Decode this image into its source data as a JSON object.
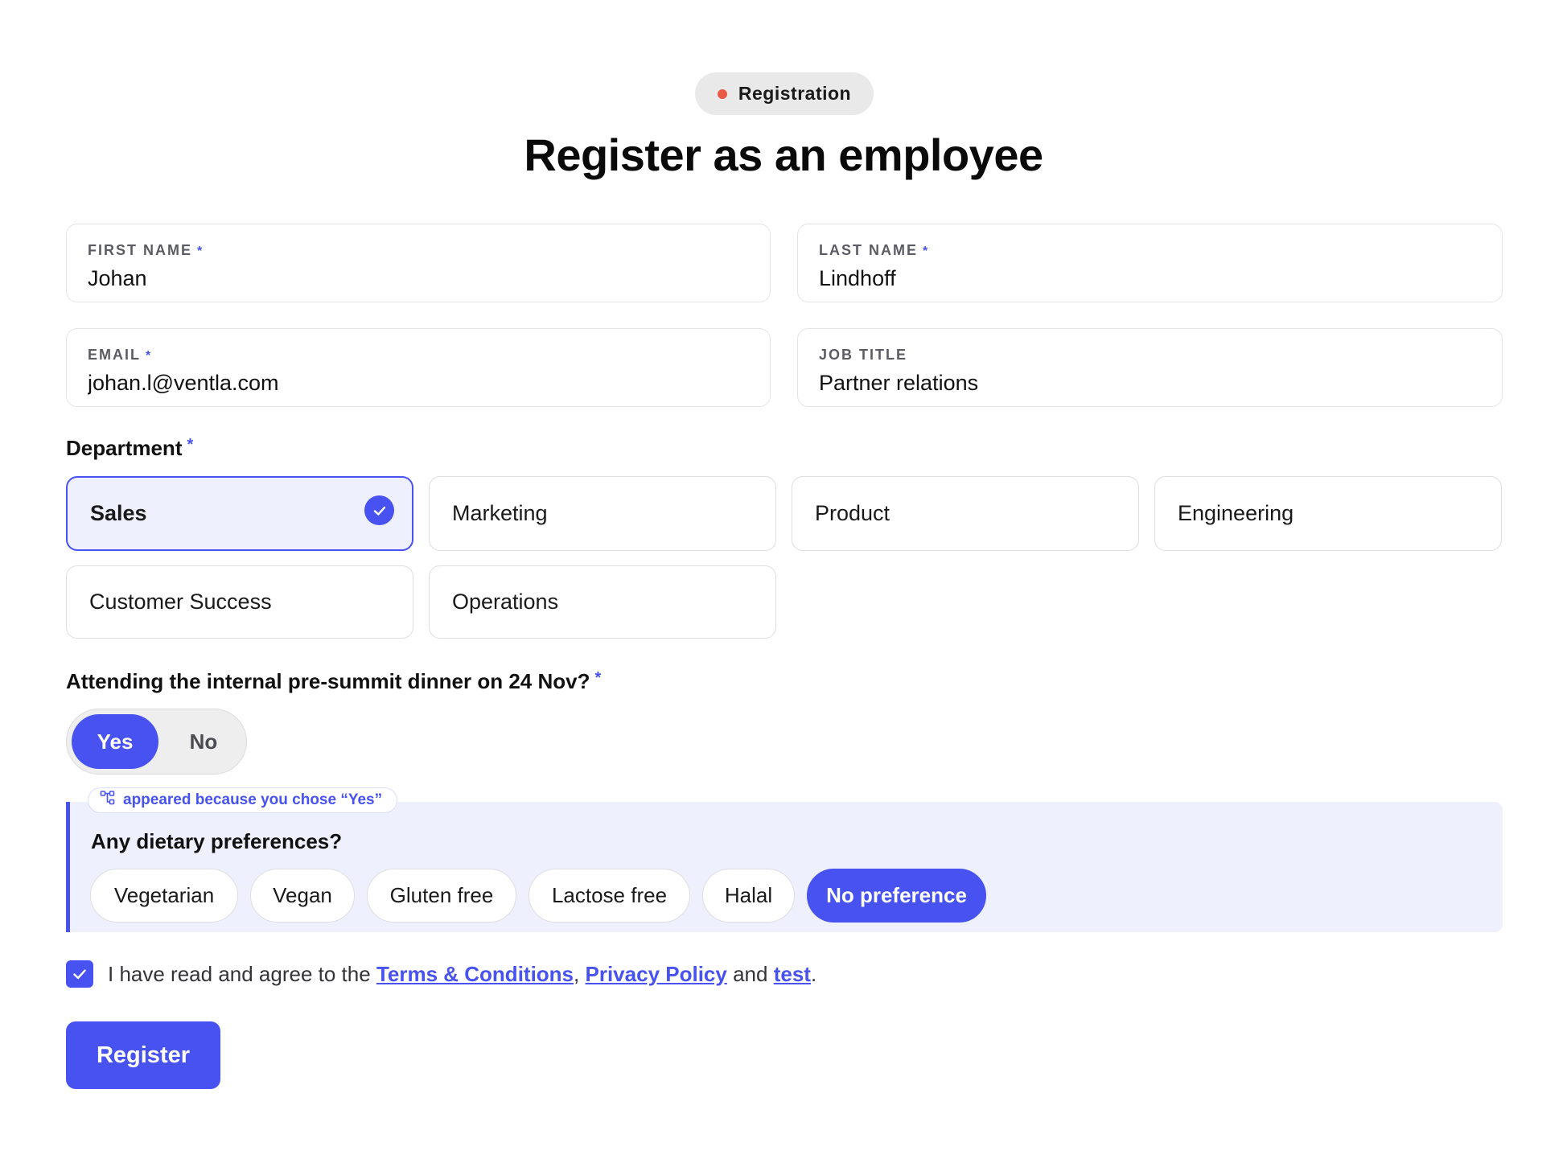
{
  "header": {
    "badge_label": "Registration",
    "title": "Register as an employee"
  },
  "fields": {
    "first_name": {
      "label": "FIRST NAME",
      "required_mark": "*",
      "value": "Johan"
    },
    "last_name": {
      "label": "LAST NAME",
      "required_mark": "*",
      "value": "Lindhoff"
    },
    "email": {
      "label": "EMAIL",
      "required_mark": "*",
      "value": "johan.l@ventla.com"
    },
    "job_title": {
      "label": "JOB TITLE",
      "value": "Partner relations"
    }
  },
  "department": {
    "label": "Department",
    "required_mark": "*",
    "options": [
      "Sales",
      "Marketing",
      "Product",
      "Engineering",
      "Customer Success",
      "Operations"
    ],
    "selected": "Sales"
  },
  "dinner": {
    "question": "Attending the internal pre-summit dinner on 24 Nov?",
    "required_mark": "*",
    "yes_label": "Yes",
    "no_label": "No",
    "selected": "Yes"
  },
  "dietary": {
    "condition_tag": "appeared because you chose “Yes”",
    "question": "Any dietary preferences?",
    "options": [
      "Vegetarian",
      "Vegan",
      "Gluten free",
      "Lactose free",
      "Halal",
      "No preference"
    ],
    "selected": "No preference"
  },
  "agreement": {
    "checked": true,
    "prefix": "I have read and agree to the",
    "terms_link": "Terms & Conditions",
    "comma": ",",
    "privacy_link": "Privacy Policy",
    "and": "and",
    "test_link": "test",
    "period": "."
  },
  "submit": {
    "label": "Register"
  },
  "colors": {
    "accent": "#4752f0",
    "badge_dot": "#e85a46",
    "selected_bg": "#eef0fe"
  },
  "icons": {
    "badge_dot": "status-dot-icon",
    "selected_check": "checkmark-circle-icon",
    "condition": "branch-icon",
    "agree_check": "checkbox-check-icon"
  }
}
